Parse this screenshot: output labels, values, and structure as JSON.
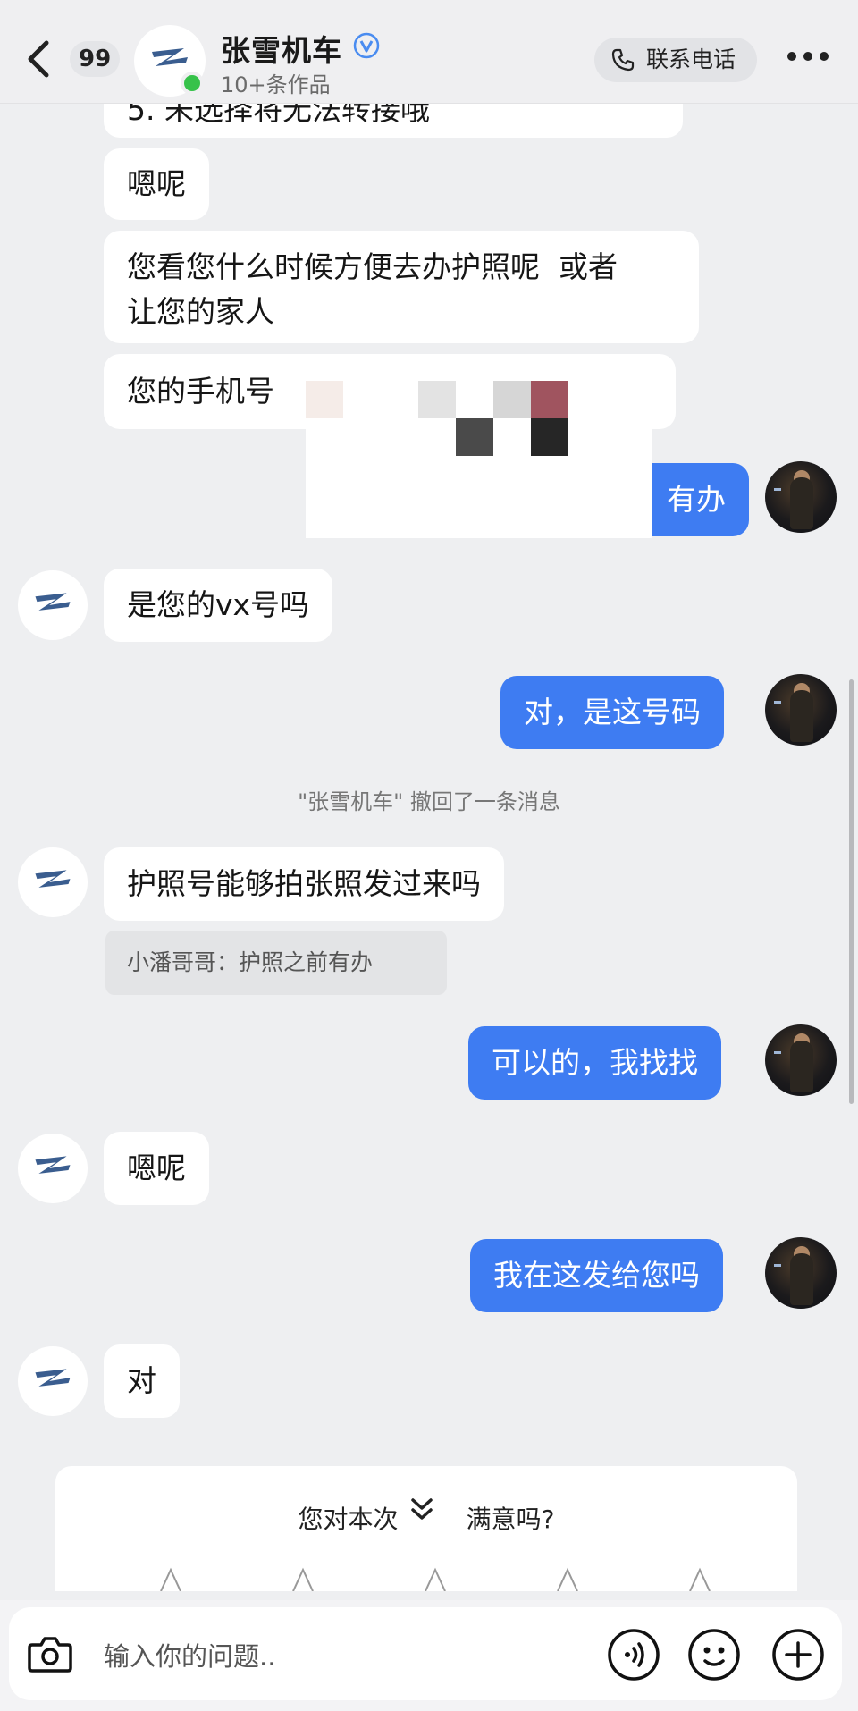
{
  "header": {
    "unread_count": "99",
    "shop_name": "张雪机车",
    "shop_subtitle": "10+条作品",
    "call_label": "联系电话"
  },
  "messages": {
    "m0_cut": "5. 未选择将无法转接哦",
    "m1": "嗯呢",
    "m2_line1": "您看您什么时候方便去办护照呢  或者",
    "m2_line2": "让您的家人",
    "m3": "您的手机号",
    "m4_me_partial": "有办",
    "m5": "是您的vx号吗",
    "m6_me": "对，是这号码",
    "system_recall": "\"张雪机车\" 撤回了一条消息",
    "m7": "护照号能够拍张照发过来吗",
    "m7_quote": "小潘哥哥：护照之前有办",
    "m8_me": "可以的，我找找",
    "m9": "嗯呢",
    "m10_me": "我在这发给您吗",
    "m11": "对"
  },
  "feedback": {
    "question_left": "您对本次",
    "question_right": "满意吗?"
  },
  "input": {
    "placeholder": "输入你的问题.."
  },
  "colors": {
    "my_bubble": "#3e7cf2",
    "other_bubble": "#ffffff",
    "background": "#eeeff1",
    "online": "#36c24a"
  },
  "icons": [
    "back-arrow-icon",
    "verified-v-icon",
    "phone-icon",
    "more-dots-icon",
    "camera-icon",
    "voice-icon",
    "emoji-icon",
    "plus-icon",
    "chevron-double-down-icon"
  ]
}
